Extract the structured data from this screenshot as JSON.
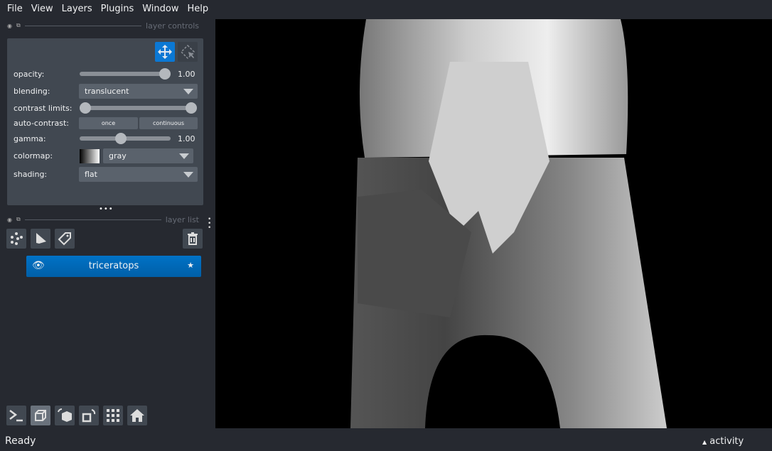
{
  "menu": [
    "File",
    "View",
    "Layers",
    "Plugins",
    "Window",
    "Help"
  ],
  "layer_controls": {
    "title": "layer controls",
    "opacity_label": "opacity:",
    "opacity_value": "1.00",
    "opacity": 1.0,
    "blending_label": "blending:",
    "blending": "translucent",
    "contrast_label": "contrast limits:",
    "contrast_range": [
      0,
      1
    ],
    "auto_contrast_label": "auto-contrast:",
    "once": "once",
    "continuous": "continuous",
    "gamma_label": "gamma:",
    "gamma_value": "1.00",
    "gamma_fraction": 0.5,
    "colormap_label": "colormap:",
    "colormap": "gray",
    "shading_label": "shading:",
    "shading": "flat"
  },
  "layer_list": {
    "title": "layer list",
    "layers": [
      {
        "name": "triceratops",
        "visible": true,
        "selected": true
      }
    ]
  },
  "accent": "#0069c0",
  "status": {
    "text": "Ready",
    "activity": "activity"
  }
}
